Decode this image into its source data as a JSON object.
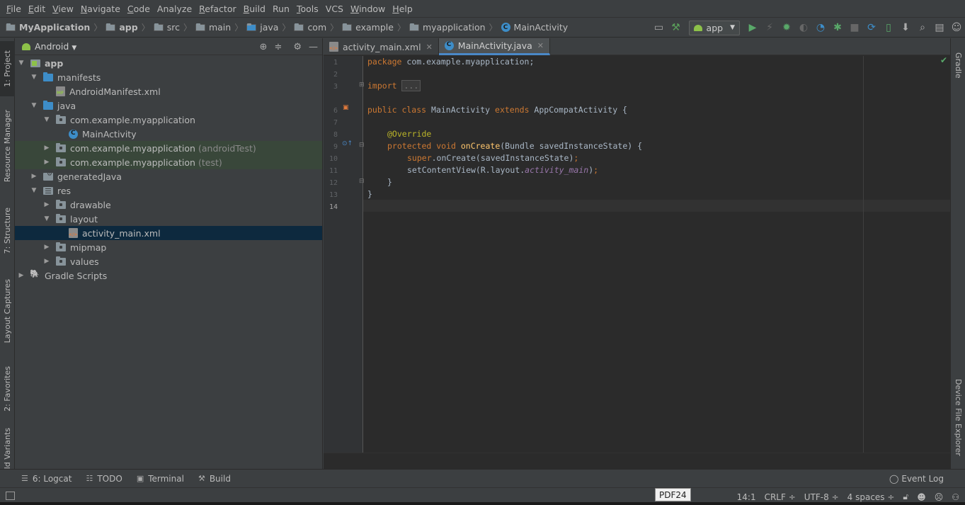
{
  "menu": [
    {
      "label": "File",
      "u": "F",
      "rest": "ile"
    },
    {
      "label": "Edit",
      "u": "E",
      "rest": "dit"
    },
    {
      "label": "View",
      "u": "V",
      "rest": "iew"
    },
    {
      "label": "Navigate",
      "u": "N",
      "rest": "avigate"
    },
    {
      "label": "Code",
      "u": "C",
      "rest": "ode"
    },
    {
      "label": "Analyze",
      "u": "",
      "rest": "Analyze"
    },
    {
      "label": "Refactor",
      "u": "R",
      "rest": "efactor"
    },
    {
      "label": "Build",
      "u": "B",
      "rest": "uild"
    },
    {
      "label": "Run",
      "u": "",
      "rest": "Run"
    },
    {
      "label": "Tools",
      "u": "T",
      "rest": "ools"
    },
    {
      "label": "VCS",
      "u": "",
      "rest": "VCS"
    },
    {
      "label": "Window",
      "u": "W",
      "rest": "indow"
    },
    {
      "label": "Help",
      "u": "H",
      "rest": "elp"
    }
  ],
  "breadcrumbs": {
    "project": "MyApplication",
    "app": "app",
    "src": "src",
    "main": "main",
    "java": "java",
    "com": "com",
    "example": "example",
    "myapplication": "myapplication",
    "cls": "MainActivity"
  },
  "run_config": "app",
  "left_tabs": {
    "project": "1: Project",
    "resource": "Resource Manager",
    "structure": "7: Structure",
    "layout": "Layout Captures",
    "favorites": "2: Favorites",
    "variants": "ld Variants"
  },
  "right_tabs": {
    "gradle": "Gradle",
    "device": "Device File Explorer"
  },
  "project_panel": {
    "view_mode": "Android",
    "tree": {
      "app": "app",
      "manifests": "manifests",
      "manifest_file": "AndroidManifest.xml",
      "java": "java",
      "pkg_main": "com.example.myapplication",
      "main_activity": "MainActivity",
      "pkg_android_test": "com.example.myapplication",
      "android_test_suffix": "(androidTest)",
      "pkg_test": "com.example.myapplication",
      "test_suffix": "(test)",
      "generated_java": "generatedJava",
      "res": "res",
      "drawable": "drawable",
      "layout": "layout",
      "activity_main": "activity_main.xml",
      "mipmap": "mipmap",
      "values": "values",
      "gradle_scripts": "Gradle Scripts"
    }
  },
  "editor": {
    "tabs": {
      "xml": "activity_main.xml",
      "java": "MainActivity.java"
    },
    "line_numbers": [
      "1",
      "2",
      "3",
      "6",
      "7",
      "8",
      "9",
      "10",
      "11",
      "12",
      "13",
      "14"
    ],
    "code": {
      "l1_kw": "package",
      "l1_rest": " com.example.myapplication;",
      "l3_kw": "import",
      "l3_fold": "...",
      "l6_kw": "public class",
      "l6_name": " MainActivity ",
      "l6_kw2": "extends",
      "l6_rest": " AppCompatActivity {",
      "l8_ann": "@Override",
      "l9_kw": "protected void",
      "l9_fn": " onCreate",
      "l9_rest": "(Bundle savedInstanceState) {",
      "l10_kw": "super",
      "l10_rest": ".onCreate(savedInstanceState)",
      "l10_semi": ";",
      "l11_a": "setContentView(R.layout.",
      "l11_fld": "activity_main",
      "l11_b": ")",
      "l11_semi": ";",
      "l12": "}",
      "l13": "}"
    }
  },
  "bottom_tools": {
    "logcat": "6: Logcat",
    "todo": "TODO",
    "terminal": "Terminal",
    "build": "Build",
    "event_log": "Event Log"
  },
  "status": {
    "pdf": "PDF24",
    "position": "14:1",
    "line_sep": "CRLF ÷",
    "encoding": "UTF-8 ÷",
    "indent": "4 spaces ÷"
  },
  "colors": {
    "background": "#3c3f41",
    "editor_bg": "#2b2b2b",
    "selection": "#0d293e",
    "keyword": "#cc7832",
    "annotation": "#bbb529",
    "function": "#ffc66d",
    "field": "#9876aa"
  }
}
